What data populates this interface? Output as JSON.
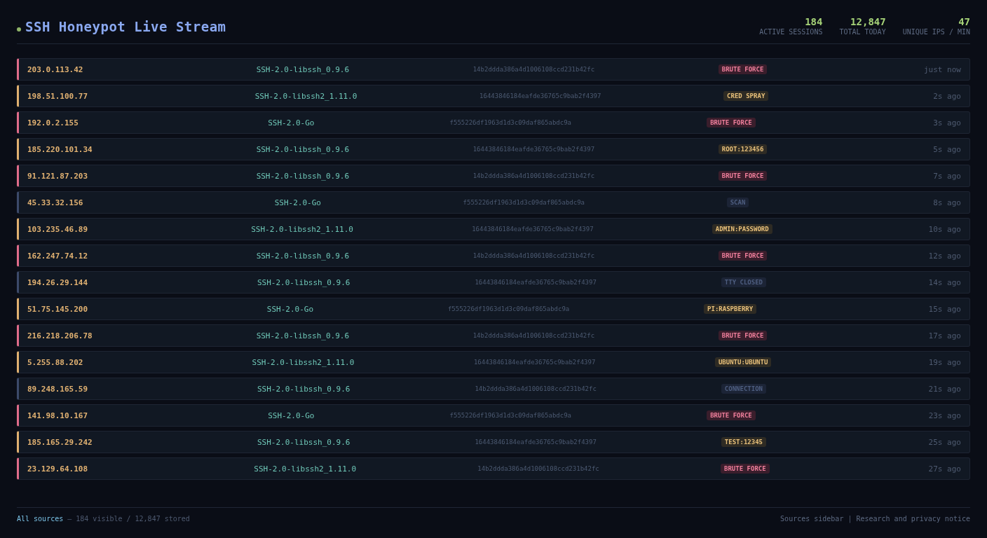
{
  "header": {
    "title": "SSH Honeypot Live Stream",
    "stats": [
      {
        "value": "184",
        "label": "ACTIVE SESSIONS"
      },
      {
        "value": "12,847",
        "label": "TOTAL TODAY"
      },
      {
        "value": "47",
        "label": "UNIQUE IPS / MIN"
      }
    ]
  },
  "events": [
    {
      "kind": "brute",
      "ip": "203.0.113.42",
      "banner": "SSH-2.0-libssh_0.9.6",
      "hash": "14b2ddda386a4d1006108ccd231b42fc",
      "tag": "BRUTE FORCE",
      "time": "just now"
    },
    {
      "kind": "cred",
      "ip": "198.51.100.77",
      "banner": "SSH-2.0-libssh2_1.11.0",
      "hash": "16443846184eafde36765c9bab2f4397",
      "tag": "CRED SPRAY",
      "time": "2s ago"
    },
    {
      "kind": "brute",
      "ip": "192.0.2.155",
      "banner": "SSH-2.0-Go",
      "hash": "f555226df1963d1d3c09daf865abdc9a",
      "tag": "BRUTE FORCE",
      "time": "3s ago"
    },
    {
      "kind": "cred",
      "ip": "185.220.101.34",
      "banner": "SSH-2.0-libssh_0.9.6",
      "hash": "16443846184eafde36765c9bab2f4397",
      "tag": "ROOT:123456",
      "time": "5s ago"
    },
    {
      "kind": "brute",
      "ip": "91.121.87.203",
      "banner": "SSH-2.0-libssh_0.9.6",
      "hash": "14b2ddda386a4d1006108ccd231b42fc",
      "tag": "BRUTE FORCE",
      "time": "7s ago"
    },
    {
      "kind": "info",
      "ip": "45.33.32.156",
      "banner": "SSH-2.0-Go",
      "hash": "f555226df1963d1d3c09daf865abdc9a",
      "tag": "SCAN",
      "time": "8s ago"
    },
    {
      "kind": "cred",
      "ip": "103.235.46.89",
      "banner": "SSH-2.0-libssh2_1.11.0",
      "hash": "16443846184eafde36765c9bab2f4397",
      "tag": "ADMIN:PASSWORD",
      "time": "10s ago"
    },
    {
      "kind": "brute",
      "ip": "162.247.74.12",
      "banner": "SSH-2.0-libssh_0.9.6",
      "hash": "14b2ddda386a4d1006108ccd231b42fc",
      "tag": "BRUTE FORCE",
      "time": "12s ago"
    },
    {
      "kind": "info",
      "ip": "194.26.29.144",
      "banner": "SSH-2.0-libssh_0.9.6",
      "hash": "16443846184eafde36765c9bab2f4397",
      "tag": "TTY CLOSED",
      "time": "14s ago"
    },
    {
      "kind": "cred",
      "ip": "51.75.145.200",
      "banner": "SSH-2.0-Go",
      "hash": "f555226df1963d1d3c09daf865abdc9a",
      "tag": "PI:RASPBERRY",
      "time": "15s ago"
    },
    {
      "kind": "brute",
      "ip": "216.218.206.78",
      "banner": "SSH-2.0-libssh_0.9.6",
      "hash": "14b2ddda386a4d1006108ccd231b42fc",
      "tag": "BRUTE FORCE",
      "time": "17s ago"
    },
    {
      "kind": "cred",
      "ip": "5.255.88.202",
      "banner": "SSH-2.0-libssh2_1.11.0",
      "hash": "16443846184eafde36765c9bab2f4397",
      "tag": "UBUNTU:UBUNTU",
      "time": "19s ago"
    },
    {
      "kind": "info",
      "ip": "89.248.165.59",
      "banner": "SSH-2.0-libssh_0.9.6",
      "hash": "14b2ddda386a4d1006108ccd231b42fc",
      "tag": "CONNECTION",
      "time": "21s ago"
    },
    {
      "kind": "brute",
      "ip": "141.98.10.167",
      "banner": "SSH-2.0-Go",
      "hash": "f555226df1963d1d3c09daf865abdc9a",
      "tag": "BRUTE FORCE",
      "time": "23s ago"
    },
    {
      "kind": "cred",
      "ip": "185.165.29.242",
      "banner": "SSH-2.0-libssh_0.9.6",
      "hash": "16443846184eafde36765c9bab2f4397",
      "tag": "TEST:12345",
      "time": "25s ago"
    },
    {
      "kind": "brute",
      "ip": "23.129.64.108",
      "banner": "SSH-2.0-libssh2_1.11.0",
      "hash": "14b2ddda386a4d1006108ccd231b42fc",
      "tag": "BRUTE FORCE",
      "time": "27s ago"
    }
  ],
  "footer": {
    "link": "All sources",
    "summary": "— 184 visible / 12,847 stored",
    "right_links": [
      "Sources sidebar",
      "Research and privacy notice"
    ],
    "separator": "|"
  }
}
